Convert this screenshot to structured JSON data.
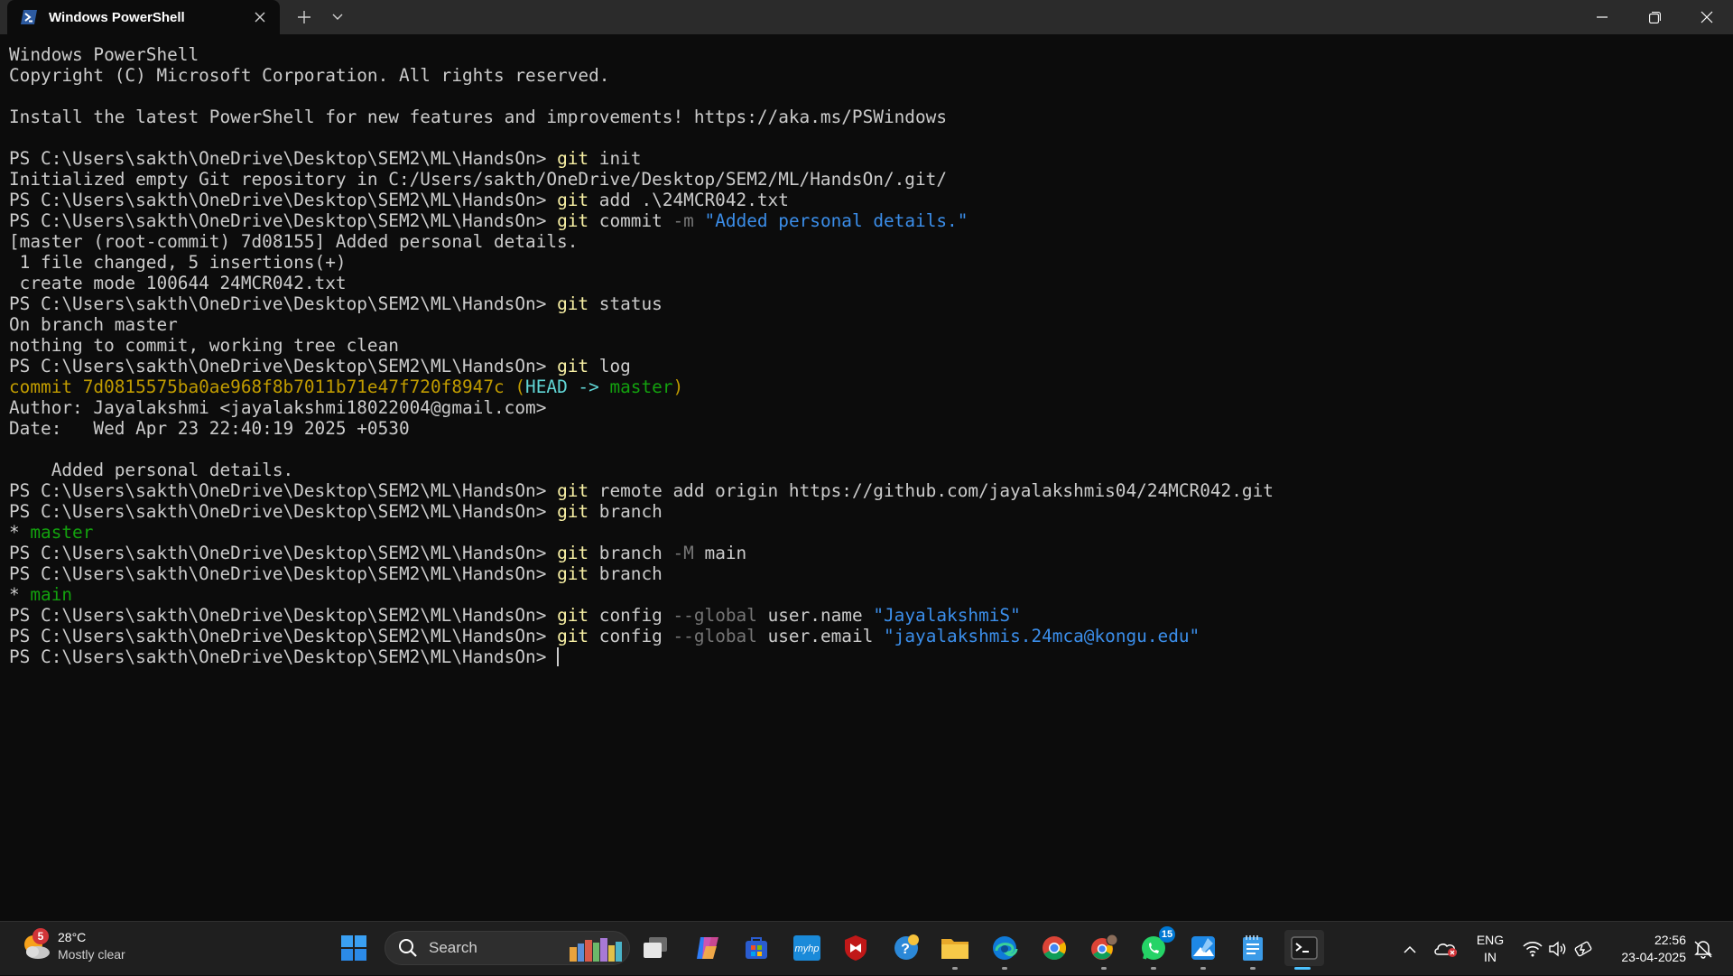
{
  "window": {
    "tab_title": "Windows PowerShell",
    "tab_icon": "powershell-icon",
    "controls": [
      "new-tab-icon",
      "chevron-down-icon",
      "minimize-icon",
      "maximize-icon",
      "close-icon"
    ]
  },
  "terminal": {
    "colors": {
      "background": "#0c0c0c",
      "text": "#cccccc",
      "command": "#f9f1a5",
      "parameter": "#767676",
      "string": "#3b8eea",
      "commit_hash": "#c19c00",
      "head": "#61d6d6",
      "branch": "#13a10e"
    },
    "lines": [
      [
        {
          "t": "Windows PowerShell",
          "c": ""
        }
      ],
      [
        {
          "t": "Copyright (C) Microsoft Corporation. All rights reserved.",
          "c": ""
        }
      ],
      [],
      [
        {
          "t": "Install the latest PowerShell for new features and improvements! https://aka.ms/PSWindows",
          "c": ""
        }
      ],
      [],
      [
        {
          "t": "PS C:\\Users\\sakth\\OneDrive\\Desktop\\SEM2\\ML\\HandsOn> ",
          "c": ""
        },
        {
          "t": "git",
          "c": "cmd"
        },
        {
          "t": " init",
          "c": ""
        }
      ],
      [
        {
          "t": "Initialized empty Git repository in C:/Users/sakth/OneDrive/Desktop/SEM2/ML/HandsOn/.git/",
          "c": ""
        }
      ],
      [
        {
          "t": "PS C:\\Users\\sakth\\OneDrive\\Desktop\\SEM2\\ML\\HandsOn> ",
          "c": ""
        },
        {
          "t": "git",
          "c": "cmd"
        },
        {
          "t": " add .\\24MCR042.txt",
          "c": ""
        }
      ],
      [
        {
          "t": "PS C:\\Users\\sakth\\OneDrive\\Desktop\\SEM2\\ML\\HandsOn> ",
          "c": ""
        },
        {
          "t": "git",
          "c": "cmd"
        },
        {
          "t": " commit ",
          "c": ""
        },
        {
          "t": "-m",
          "c": "param"
        },
        {
          "t": " ",
          "c": ""
        },
        {
          "t": "\"Added personal details.\"",
          "c": "str"
        }
      ],
      [
        {
          "t": "[master (root-commit) 7d08155] Added personal details.",
          "c": ""
        }
      ],
      [
        {
          "t": " 1 file changed, 5 insertions(+)",
          "c": ""
        }
      ],
      [
        {
          "t": " create mode 100644 24MCR042.txt",
          "c": ""
        }
      ],
      [
        {
          "t": "PS C:\\Users\\sakth\\OneDrive\\Desktop\\SEM2\\ML\\HandsOn> ",
          "c": ""
        },
        {
          "t": "git",
          "c": "cmd"
        },
        {
          "t": " status",
          "c": ""
        }
      ],
      [
        {
          "t": "On branch master",
          "c": ""
        }
      ],
      [
        {
          "t": "nothing to commit, working tree clean",
          "c": ""
        }
      ],
      [
        {
          "t": "PS C:\\Users\\sakth\\OneDrive\\Desktop\\SEM2\\ML\\HandsOn> ",
          "c": ""
        },
        {
          "t": "git",
          "c": "cmd"
        },
        {
          "t": " log",
          "c": ""
        }
      ],
      [
        {
          "t": "commit 7d0815575ba0ae968f8b7011b71e47f720f8947c (",
          "c": "hash"
        },
        {
          "t": "HEAD -> ",
          "c": "head"
        },
        {
          "t": "master",
          "c": "br"
        },
        {
          "t": ")",
          "c": "hash"
        }
      ],
      [
        {
          "t": "Author: Jayalakshmi <jayalakshmi18022004@gmail.com>",
          "c": ""
        }
      ],
      [
        {
          "t": "Date:   Wed Apr 23 22:40:19 2025 +0530",
          "c": ""
        }
      ],
      [],
      [
        {
          "t": "    Added personal details.",
          "c": ""
        }
      ],
      [
        {
          "t": "PS C:\\Users\\sakth\\OneDrive\\Desktop\\SEM2\\ML\\HandsOn> ",
          "c": ""
        },
        {
          "t": "git",
          "c": "cmd"
        },
        {
          "t": " remote add origin https://github.com/jayalakshmis04/24MCR042.git",
          "c": ""
        }
      ],
      [
        {
          "t": "PS C:\\Users\\sakth\\OneDrive\\Desktop\\SEM2\\ML\\HandsOn> ",
          "c": ""
        },
        {
          "t": "git",
          "c": "cmd"
        },
        {
          "t": " branch",
          "c": ""
        }
      ],
      [
        {
          "t": "* ",
          "c": ""
        },
        {
          "t": "master",
          "c": "br"
        }
      ],
      [
        {
          "t": "PS C:\\Users\\sakth\\OneDrive\\Desktop\\SEM2\\ML\\HandsOn> ",
          "c": ""
        },
        {
          "t": "git",
          "c": "cmd"
        },
        {
          "t": " branch ",
          "c": ""
        },
        {
          "t": "-M",
          "c": "param"
        },
        {
          "t": " main",
          "c": ""
        }
      ],
      [
        {
          "t": "PS C:\\Users\\sakth\\OneDrive\\Desktop\\SEM2\\ML\\HandsOn> ",
          "c": ""
        },
        {
          "t": "git",
          "c": "cmd"
        },
        {
          "t": " branch",
          "c": ""
        }
      ],
      [
        {
          "t": "* ",
          "c": ""
        },
        {
          "t": "main",
          "c": "br"
        }
      ],
      [
        {
          "t": "PS C:\\Users\\sakth\\OneDrive\\Desktop\\SEM2\\ML\\HandsOn> ",
          "c": ""
        },
        {
          "t": "git",
          "c": "cmd"
        },
        {
          "t": " config ",
          "c": ""
        },
        {
          "t": "--global",
          "c": "param"
        },
        {
          "t": " user.name ",
          "c": ""
        },
        {
          "t": "\"JayalakshmiS\"",
          "c": "str"
        }
      ],
      [
        {
          "t": "PS C:\\Users\\sakth\\OneDrive\\Desktop\\SEM2\\ML\\HandsOn> ",
          "c": ""
        },
        {
          "t": "git",
          "c": "cmd"
        },
        {
          "t": " config ",
          "c": ""
        },
        {
          "t": "--global",
          "c": "param"
        },
        {
          "t": " user.email ",
          "c": ""
        },
        {
          "t": "\"jayalakshmis.24mca@kongu.edu\"",
          "c": "str"
        }
      ],
      [
        {
          "t": "PS C:\\Users\\sakth\\OneDrive\\Desktop\\SEM2\\ML\\HandsOn> ",
          "c": ""
        }
      ]
    ]
  },
  "taskbar": {
    "weather": {
      "temp": "28°C",
      "condition": "Mostly clear",
      "badge": "5",
      "icon": "weather-moon-cloud-icon"
    },
    "search": {
      "placeholder": "Search",
      "icon": "search-icon"
    },
    "apps": [
      {
        "name": "start",
        "icon": "windows-start-icon"
      },
      {
        "name": "task-view",
        "icon": "task-view-icon"
      },
      {
        "name": "copilot",
        "icon": "copilot-icon"
      },
      {
        "name": "microsoft-store",
        "icon": "store-icon"
      },
      {
        "name": "myhp",
        "icon": "myhp-icon",
        "text": "myhp"
      },
      {
        "name": "mcafee",
        "icon": "mcafee-icon"
      },
      {
        "name": "get-help",
        "icon": "help-icon"
      },
      {
        "name": "file-explorer",
        "icon": "folder-icon"
      },
      {
        "name": "edge",
        "icon": "edge-icon"
      },
      {
        "name": "chrome",
        "icon": "chrome-icon"
      },
      {
        "name": "chrome-profile",
        "icon": "chrome-profile-icon"
      },
      {
        "name": "whatsapp",
        "icon": "whatsapp-icon",
        "badge": "15"
      },
      {
        "name": "photos",
        "icon": "photos-icon"
      },
      {
        "name": "notepad",
        "icon": "notepad-icon"
      },
      {
        "name": "terminal",
        "icon": "terminal-icon"
      }
    ],
    "tray": {
      "language_line1": "ENG",
      "language_line2": "IN",
      "time": "22:56",
      "date": "23-04-2025"
    }
  }
}
